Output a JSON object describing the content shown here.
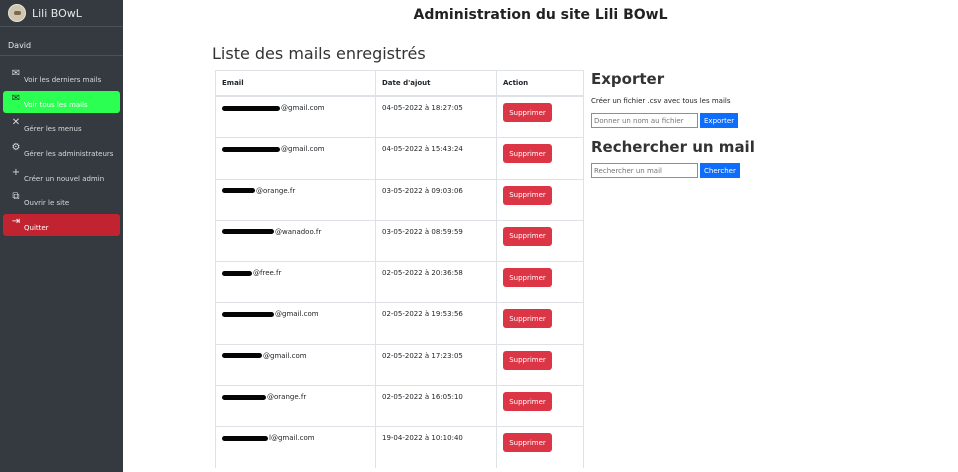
{
  "brand": {
    "name": "Lili BOwL"
  },
  "user": {
    "name": "David"
  },
  "nav": [
    {
      "label": "Voir les derniers mails",
      "icon": "envelope-icon"
    },
    {
      "label": "Voir tous les mails",
      "icon": "envelope-open-icon"
    },
    {
      "label": "Gérer les menus",
      "icon": "utensils-icon"
    },
    {
      "label": "Gérer les administrateurs",
      "icon": "users-cog-icon"
    },
    {
      "label": "Créer un nouvel admin",
      "icon": "user-plus-icon"
    },
    {
      "label": "Ouvrir le site",
      "icon": "external-link-icon"
    },
    {
      "label": "Quitter",
      "icon": "sign-out-icon"
    }
  ],
  "header": {
    "title": "Administration du site Lili BOwL"
  },
  "list": {
    "title": "Liste des mails enregistrés",
    "columns": [
      "Email",
      "Date d'ajout",
      "Action"
    ],
    "delete_label": "Supprimer",
    "rows": [
      {
        "email": "@gmail.com",
        "date": "04-05-2022 à 18:27:05"
      },
      {
        "email": "@gmail.com",
        "date": "04-05-2022 à 15:43:24"
      },
      {
        "email": "@orange.fr",
        "date": "03-05-2022 à 09:03:06"
      },
      {
        "email": "@wanadoo.fr",
        "date": "03-05-2022 à 08:59:59"
      },
      {
        "email": "@free.fr",
        "date": "02-05-2022 à 20:36:58"
      },
      {
        "email": "@gmail.com",
        "date": "02-05-2022 à 19:53:56"
      },
      {
        "email": "@gmail.com",
        "date": "02-05-2022 à 17:23:05"
      },
      {
        "email": "@orange.fr",
        "date": "02-05-2022 à 16:05:10"
      },
      {
        "email": "l@gmail.com",
        "date": "19-04-2022 à 10:10:40"
      }
    ]
  },
  "export": {
    "title": "Exporter",
    "description": "Créer un fichier .csv avec tous les mails",
    "placeholder": "Donner un nom au fichier",
    "button": "Exporter"
  },
  "search": {
    "title": "Rechercher un mail",
    "placeholder": "Rechercher un mail",
    "button": "Chercher"
  }
}
